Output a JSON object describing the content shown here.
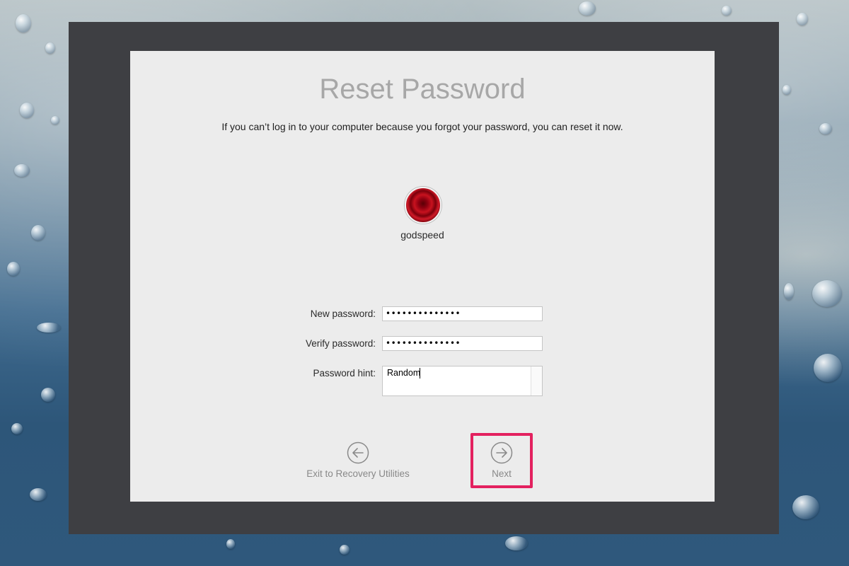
{
  "title": "Reset Password",
  "subtitle": "If you can’t log in to your computer because you forgot your password, you can reset it now.",
  "user": {
    "name": "godspeed"
  },
  "form": {
    "new_password": {
      "label": "New password:",
      "value": "••••••••••••••"
    },
    "verify_password": {
      "label": "Verify password:",
      "value": "••••••••••••••"
    },
    "password_hint": {
      "label": "Password hint:",
      "value": "Random"
    }
  },
  "nav": {
    "exit_label": "Exit to Recovery Utilities",
    "next_label": "Next"
  },
  "colors": {
    "highlight": "#e3215f",
    "panel": "#ececec",
    "window": "#3e3f43"
  }
}
